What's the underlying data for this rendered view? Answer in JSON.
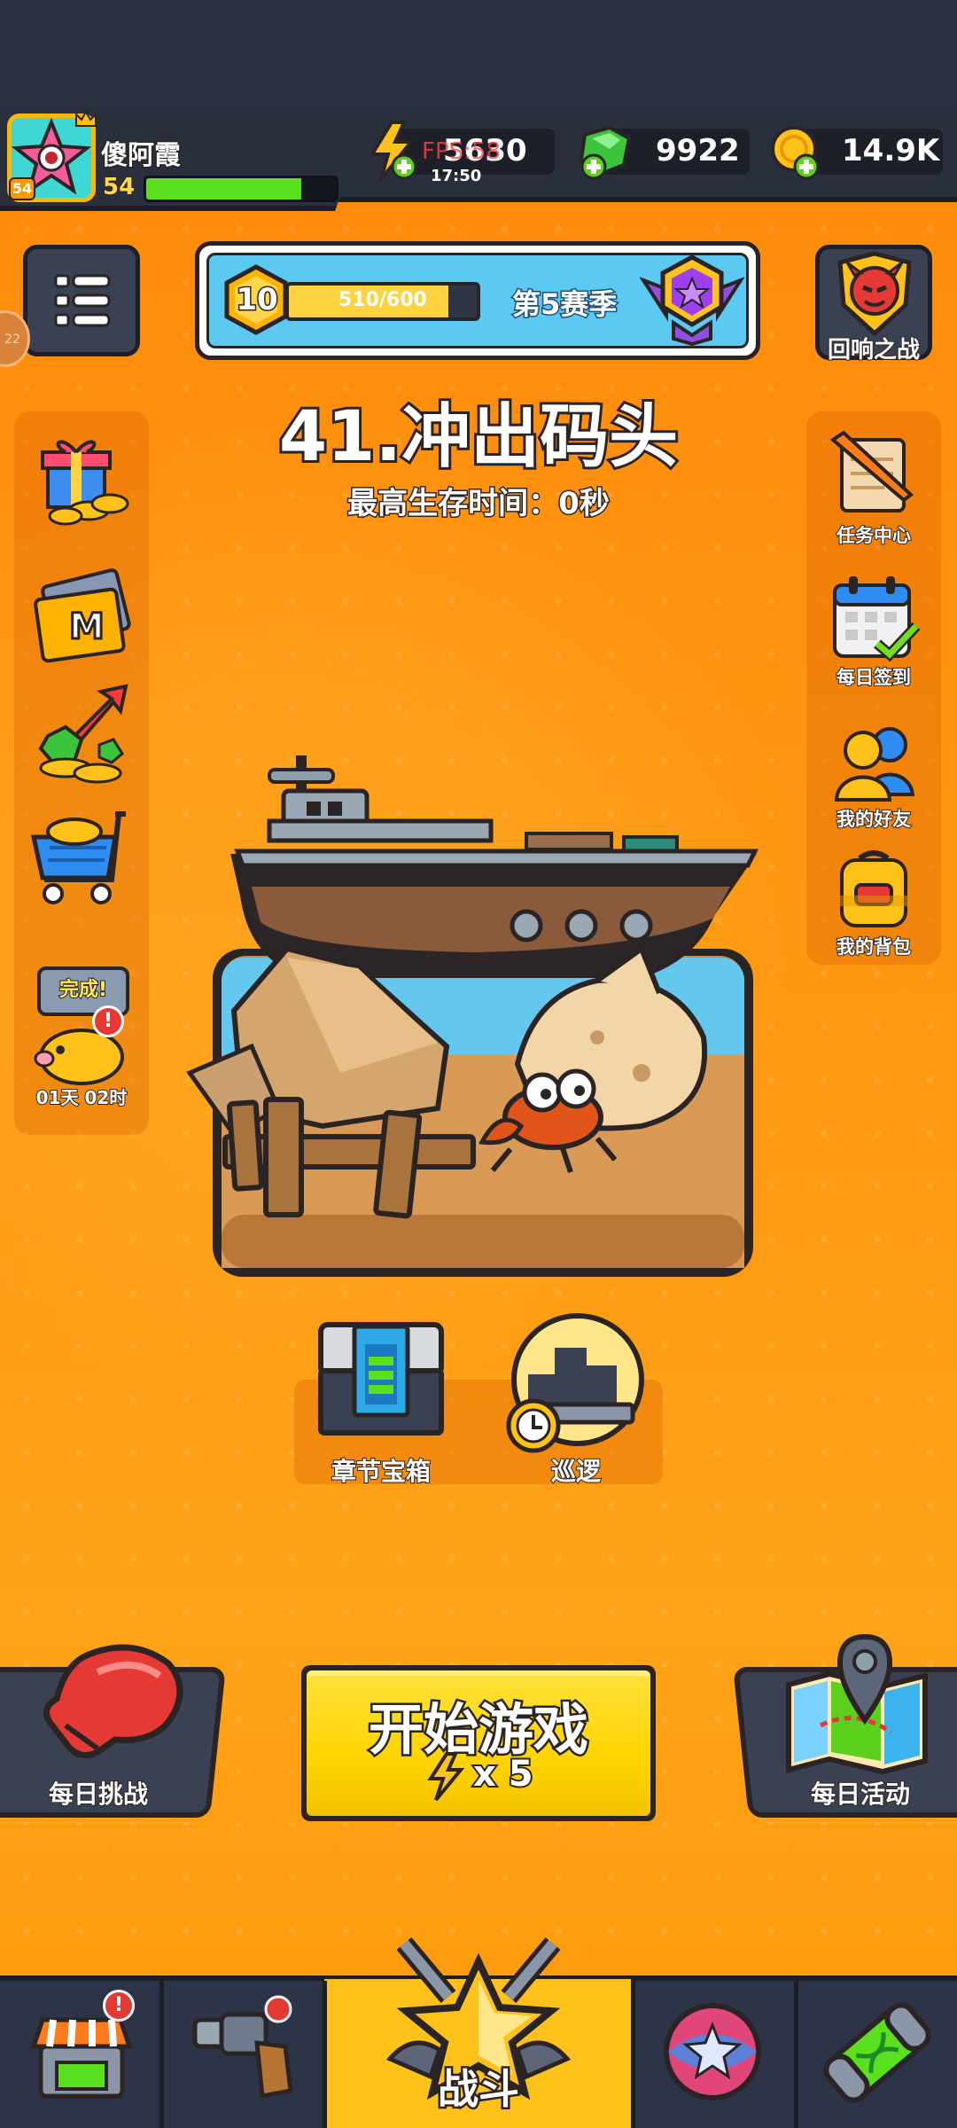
{
  "player": {
    "name": "傻阿霞",
    "level": "54",
    "avatar_badge": "54"
  },
  "overlay": {
    "fps": "FPS:58",
    "time": "17:50"
  },
  "resources": {
    "energy": "5630",
    "gems": "9922",
    "coins": "14.9K"
  },
  "season": {
    "level": "10",
    "progress": "510/600",
    "progress_fraction": 0.85,
    "name": "第5赛季"
  },
  "side_badge": "22",
  "echo_battle_label": "回响之战",
  "stage": {
    "title": "41.冲出码头",
    "subtitle": "最高生存时间：0秒"
  },
  "right_menu": [
    {
      "label": "任务中心",
      "icon": "scroll-quill-icon"
    },
    {
      "label": "每日签到",
      "icon": "calendar-check-icon"
    },
    {
      "label": "我的好友",
      "icon": "friends-icon"
    },
    {
      "label": "我的背包",
      "icon": "backpack-icon"
    }
  ],
  "left_menu": [
    {
      "icon": "gift-icon"
    },
    {
      "icon": "monthly-card-icon"
    },
    {
      "icon": "growth-fund-icon"
    },
    {
      "icon": "shop-cart-icon"
    }
  ],
  "piggy": {
    "tag": "完成!",
    "badge": "!",
    "timer": "01天 02时"
  },
  "chapter_chest_label": "章节宝箱",
  "patrol_label": "巡逻",
  "daily_challenge_label": "每日挑战",
  "start_button": {
    "label": "开始游戏",
    "cost": "x 5"
  },
  "daily_activity_label": "每日活动",
  "bottom_nav": {
    "battle_label": "战斗",
    "shop_badge": "!"
  },
  "colors": {
    "orange_bg": "#ff8f0d",
    "dark_panel": "#2d3142",
    "accent_yellow": "#ffd400",
    "green_bar": "#5be01f"
  }
}
